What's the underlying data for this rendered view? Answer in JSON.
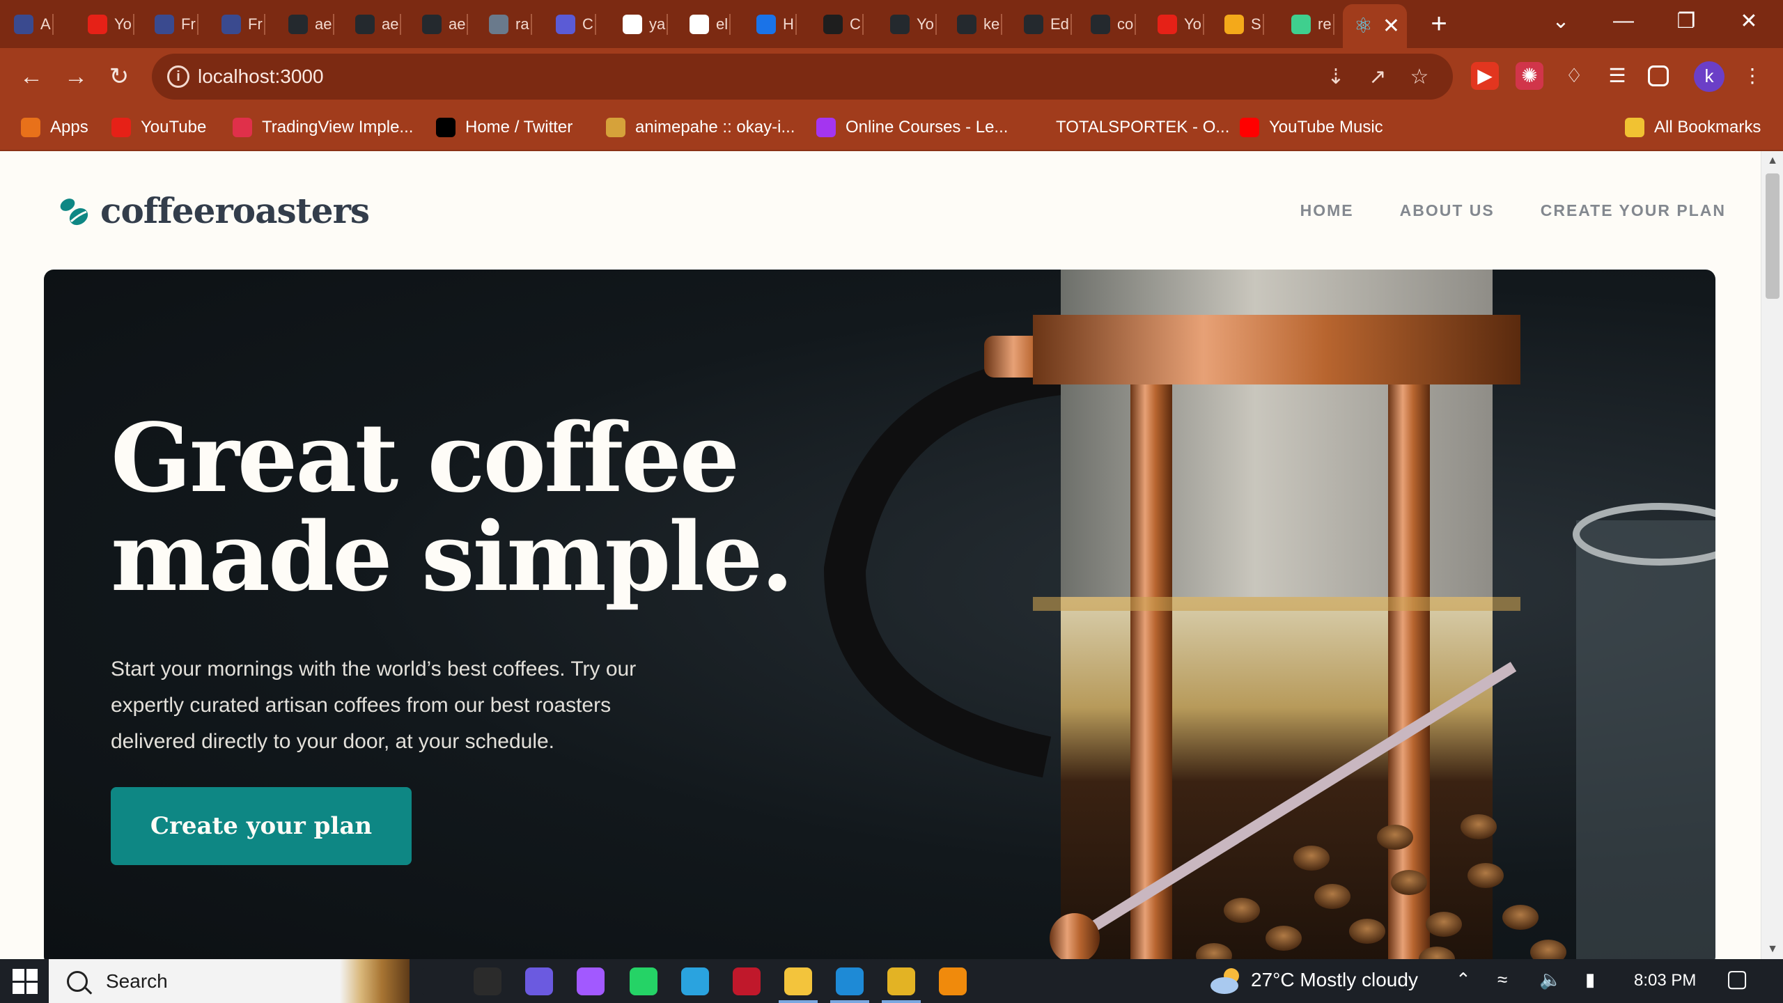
{
  "browser": {
    "tabs": [
      {
        "label": "A",
        "color": "#3a4a8f"
      },
      {
        "label": "Yo",
        "color": "#e62117"
      },
      {
        "label": "Fr",
        "color": "#3a4a8f"
      },
      {
        "label": "Fr",
        "color": "#3a4a8f"
      },
      {
        "label": "ae",
        "color": "#24292e"
      },
      {
        "label": "ae",
        "color": "#24292e"
      },
      {
        "label": "ae",
        "color": "#24292e"
      },
      {
        "label": "ra",
        "color": "#6a7a8c"
      },
      {
        "label": "C",
        "color": "#5b5bd6"
      },
      {
        "label": "ya",
        "color": "#ffffff"
      },
      {
        "label": "el",
        "color": "#ffffff"
      },
      {
        "label": "H",
        "color": "#1a73e8"
      },
      {
        "label": "C",
        "color": "#1e1e1e"
      },
      {
        "label": "Yo",
        "color": "#24292e"
      },
      {
        "label": "ke",
        "color": "#24292e"
      },
      {
        "label": "Ed",
        "color": "#24292e"
      },
      {
        "label": "co",
        "color": "#24292e"
      },
      {
        "label": "Yo",
        "color": "#e62117"
      },
      {
        "label": "S",
        "color": "#f4a91a"
      },
      {
        "label": "re",
        "color": "#3fcf8e"
      }
    ],
    "active_tab_icon": "react-icon",
    "url": "localhost:3000",
    "profile_initial": "k",
    "bookmarks": [
      {
        "label": "Apps",
        "icon": "apps-grid-icon",
        "color": "#e8711a"
      },
      {
        "label": "YouTube",
        "icon": "youtube-icon",
        "color": "#e62117"
      },
      {
        "label": "TradingView Imple...",
        "icon": "tradingview-icon",
        "color": "#e0304a"
      },
      {
        "label": "Home / Twitter",
        "icon": "x-icon",
        "color": "#000000"
      },
      {
        "label": "animepahe :: okay-i...",
        "icon": "animepahe-icon",
        "color": "#d6a23a"
      },
      {
        "label": "Online Courses - Le...",
        "icon": "udemy-icon",
        "color": "#a435f0"
      },
      {
        "label": "TOTALSPORTEK - O...",
        "icon": "totalsportek-icon",
        "color": "#a13c1c"
      },
      {
        "label": "YouTube Music",
        "icon": "youtube-music-icon",
        "color": "#ff0000"
      }
    ],
    "all_bookmarks": "All Bookmarks"
  },
  "site": {
    "logo_text": "coffeeroasters",
    "nav": [
      "HOME",
      "ABOUT US",
      "CREATE YOUR PLAN"
    ],
    "hero": {
      "title_line1": "Great coffee",
      "title_line2": "made simple.",
      "body": "Start your mornings with the world’s best coffees. Try our expertly curated artisan coffees from our best roasters delivered directly to your door, at your schedule.",
      "cta": "Create your plan"
    },
    "colors": {
      "accent": "#0e8784",
      "dark_text": "#333d4b",
      "nav_text": "#83888f",
      "cream": "#fefcf7"
    }
  },
  "taskbar": {
    "search_label": "Search",
    "weather": "27°C  Mostly cloudy",
    "time": "8:03 PM",
    "apps": [
      {
        "name": "task-view-icon",
        "color": "#1c2026"
      },
      {
        "name": "app-icon",
        "color": "#2b2b2b"
      },
      {
        "name": "media-player-icon",
        "color": "#6b5ae0"
      },
      {
        "name": "figma-icon",
        "color": "#a259ff"
      },
      {
        "name": "whatsapp-icon",
        "color": "#25d366"
      },
      {
        "name": "telegram-icon",
        "color": "#2aa3df"
      },
      {
        "name": "terminal-icon",
        "color": "#c0182b"
      },
      {
        "name": "file-explorer-icon",
        "color": "#f3c43c"
      },
      {
        "name": "vscode-icon",
        "color": "#1e8ad6"
      },
      {
        "name": "chrome-icon",
        "color": "#e3b324"
      },
      {
        "name": "vlc-icon",
        "color": "#f08a0c"
      }
    ]
  }
}
